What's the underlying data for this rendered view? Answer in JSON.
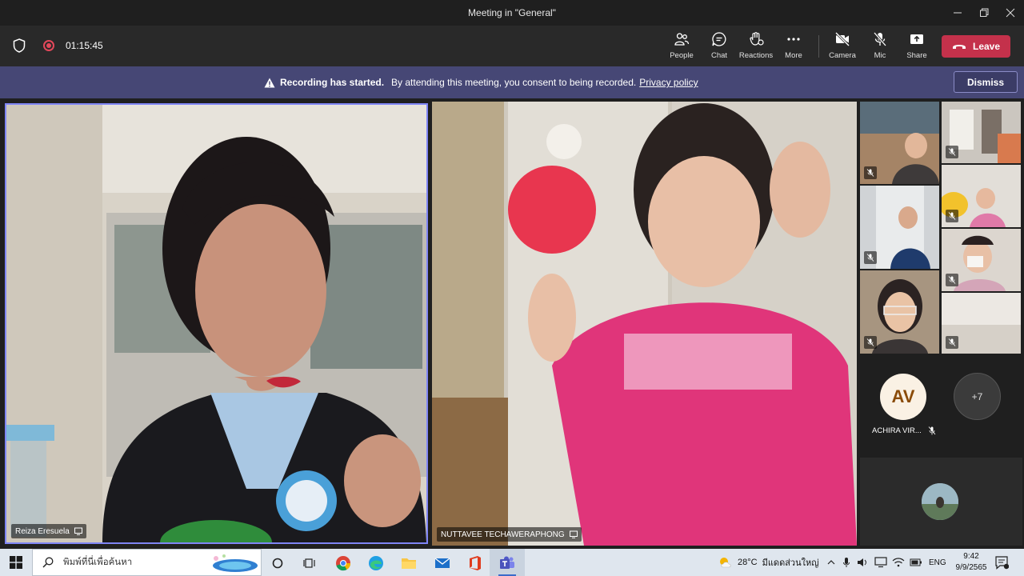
{
  "window": {
    "title": "Meeting in \"General\""
  },
  "toolbar": {
    "timer": "01:15:45",
    "buttons": {
      "people": "People",
      "chat": "Chat",
      "reactions": "Reactions",
      "more": "More",
      "camera": "Camera",
      "mic": "Mic",
      "share": "Share"
    },
    "leave_label": "Leave"
  },
  "banner": {
    "title": "Recording has started.",
    "message": "By attending this meeting, you consent to being recorded.",
    "link": "Privacy policy",
    "dismiss_label": "Dismiss"
  },
  "participants": {
    "main": [
      {
        "name": "Reiza Eresuela"
      },
      {
        "name": "NUTTAVEE TECHAWERAPHONG"
      }
    ],
    "avatar_initials": "AV",
    "avatar_name": "ACHIRA VIR...",
    "more_count": "+7"
  },
  "taskbar": {
    "search_placeholder": "พิมพ์ที่นี่เพื่อค้นหา",
    "weather": "28°C",
    "weather_desc": "มีแดดส่วนใหญ่",
    "language": "ENG",
    "time": "9:42",
    "date": "9/9/2565"
  },
  "colors": {
    "leave": "#c4314b",
    "banner": "#464775",
    "accent": "#7f85f5"
  }
}
